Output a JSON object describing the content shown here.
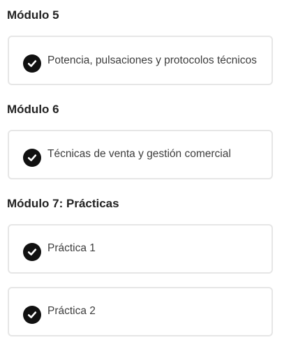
{
  "modules": [
    {
      "title": "Módulo 5",
      "items": [
        {
          "label": "Potencia, pulsaciones y protocolos técnicos",
          "completed": true,
          "icon": "check-circle-icon"
        }
      ]
    },
    {
      "title": "Módulo 6",
      "items": [
        {
          "label": "Técnicas de venta y gestión comercial",
          "completed": true,
          "icon": "check-circle-icon"
        }
      ]
    },
    {
      "title": "Módulo 7: Prácticas",
      "items": [
        {
          "label": "Práctica 1",
          "completed": true,
          "icon": "check-circle-icon"
        },
        {
          "label": "Práctica 2",
          "completed": true,
          "icon": "check-circle-icon"
        }
      ]
    }
  ],
  "colors": {
    "text": "#222222",
    "item_text": "#3d3d3d",
    "card_border": "#e6e6e6",
    "check_fill": "#111111"
  }
}
